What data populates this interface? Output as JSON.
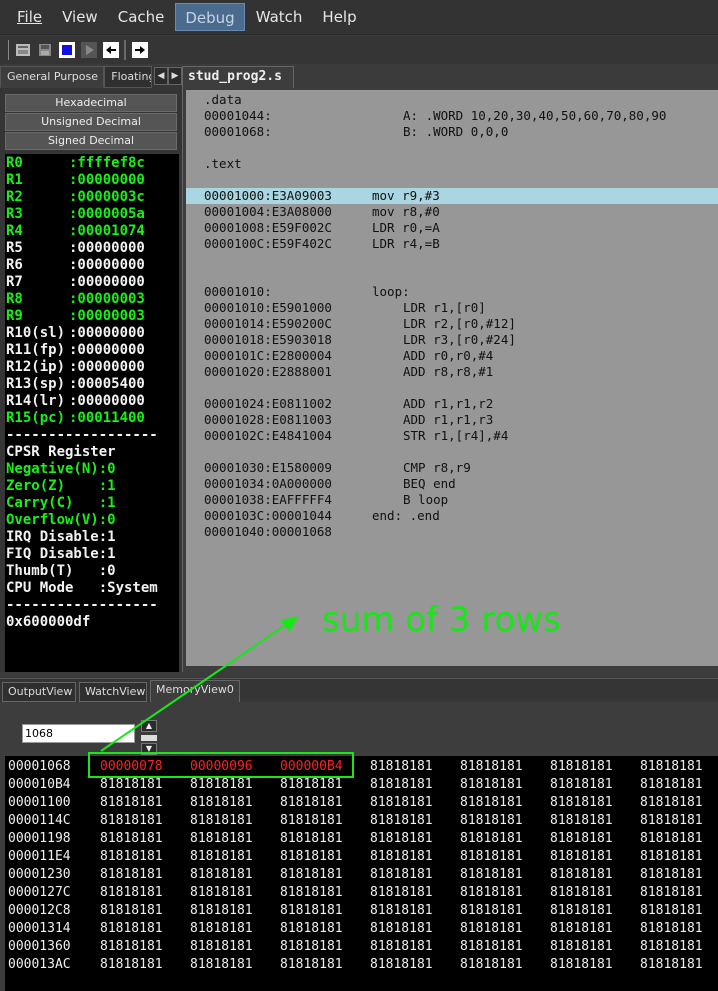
{
  "menu": [
    "File",
    "View",
    "Cache",
    "Debug",
    "Watch",
    "Help"
  ],
  "menu_active": "Debug",
  "toolbar_icons": [
    "open-file-icon",
    "save-file-icon",
    "stop-icon",
    "run-icon",
    "step-into-icon",
    "step-over-icon"
  ],
  "left_tabs": {
    "general": "General Purpose",
    "floating": "Floating"
  },
  "modes": [
    "Hexadecimal",
    "Unsigned Decimal",
    "Signed Decimal"
  ],
  "registers": [
    {
      "name": "R0",
      "value": ":ffffef8c",
      "color": "green"
    },
    {
      "name": "R1",
      "value": ":00000000",
      "color": "green"
    },
    {
      "name": "R2",
      "value": ":0000003c",
      "color": "green"
    },
    {
      "name": "R3",
      "value": ":0000005a",
      "color": "green"
    },
    {
      "name": "R4",
      "value": ":00001074",
      "color": "green"
    },
    {
      "name": "R5",
      "value": ":00000000",
      "color": "white"
    },
    {
      "name": "R6",
      "value": ":00000000",
      "color": "white"
    },
    {
      "name": "R7",
      "value": ":00000000",
      "color": "white"
    },
    {
      "name": "R8",
      "value": ":00000003",
      "color": "green"
    },
    {
      "name": "R9",
      "value": ":00000003",
      "color": "green"
    },
    {
      "name": "R10(sl)",
      "value": ":00000000",
      "color": "white"
    },
    {
      "name": "R11(fp)",
      "value": ":00000000",
      "color": "white"
    },
    {
      "name": "R12(ip)",
      "value": ":00000000",
      "color": "white"
    },
    {
      "name": "R13(sp)",
      "value": ":00005400",
      "color": "white"
    },
    {
      "name": "R14(lr)",
      "value": ":00000000",
      "color": "white"
    },
    {
      "name": "R15(pc)",
      "value": ":00011400",
      "color": "green"
    }
  ],
  "separator": "------------------",
  "cpsr_title": "CPSR Register",
  "cpsr": [
    {
      "text": "Negative(N):0",
      "color": "green"
    },
    {
      "text": "Zero(Z)    :1",
      "color": "green"
    },
    {
      "text": "Carry(C)   :1",
      "color": "green"
    },
    {
      "text": "Overflow(V):0",
      "color": "green"
    },
    {
      "text": "IRQ Disable:1",
      "color": "white"
    },
    {
      "text": "FIQ Disable:1",
      "color": "white"
    },
    {
      "text": "Thumb(T)   :0",
      "color": "white"
    },
    {
      "text": "CPU Mode   :System",
      "color": "white"
    }
  ],
  "cpsr_value": "0x600000df",
  "editor_tab": "stud_prog2.s",
  "code_lines": [
    {
      "a": ".data",
      "b": "",
      "c": ""
    },
    {
      "a": "00001044:",
      "b": "",
      "c": "A: .WORD 10,20,30,40,50,60,70,80,90"
    },
    {
      "a": "00001068:",
      "b": "",
      "c": "B: .WORD 0,0,0"
    },
    {
      "a": "",
      "b": "",
      "c": ""
    },
    {
      "a": ".text",
      "b": "",
      "c": ""
    },
    {
      "a": "",
      "b": "",
      "c": ""
    },
    {
      "a": "00001000:E3A09003",
      "b": "mov r9,#3",
      "c": "",
      "hl": true
    },
    {
      "a": "00001004:E3A08000",
      "b": "mov r8,#0",
      "c": ""
    },
    {
      "a": "00001008:E59F002C",
      "b": "LDR r0,=A",
      "c": ""
    },
    {
      "a": "0000100C:E59F402C",
      "b": "LDR r4,=B",
      "c": ""
    },
    {
      "a": "",
      "b": "",
      "c": ""
    },
    {
      "a": "",
      "b": "",
      "c": ""
    },
    {
      "a": "00001010:",
      "b": "loop:",
      "c": ""
    },
    {
      "a": "00001010:E5901000",
      "b": "",
      "c": "LDR r1,[r0]"
    },
    {
      "a": "00001014:E590200C",
      "b": "",
      "c": "LDR r2,[r0,#12]"
    },
    {
      "a": "00001018:E5903018",
      "b": "",
      "c": "LDR r3,[r0,#24]"
    },
    {
      "a": "0000101C:E2800004",
      "b": "",
      "c": "ADD r0,r0,#4"
    },
    {
      "a": "00001020:E2888001",
      "b": "",
      "c": "ADD r8,r8,#1"
    },
    {
      "a": "",
      "b": "",
      "c": ""
    },
    {
      "a": "00001024:E0811002",
      "b": "",
      "c": "ADD r1,r1,r2"
    },
    {
      "a": "00001028:E0811003",
      "b": "",
      "c": "ADD r1,r1,r3"
    },
    {
      "a": "0000102C:E4841004",
      "b": "",
      "c": "STR r1,[r4],#4"
    },
    {
      "a": "",
      "b": "",
      "c": ""
    },
    {
      "a": "00001030:E1580009",
      "b": "",
      "c": "CMP r8,r9"
    },
    {
      "a": "00001034:0A000000",
      "b": "",
      "c": "BEQ end"
    },
    {
      "a": "00001038:EAFFFFF4",
      "b": "",
      "c": "B loop"
    },
    {
      "a": "0000103C:00001044",
      "b": "end: .end",
      "c": ""
    },
    {
      "a": "00001040:00001068",
      "b": "",
      "c": ""
    }
  ],
  "annotation": "sum of 3 rows",
  "bottom_tabs": [
    "OutputView",
    "WatchView",
    "MemoryView0"
  ],
  "address_input": "1068",
  "memory_rows": [
    {
      "addr": "00001068",
      "cells": [
        "00000078",
        "00000096",
        "000000B4",
        "81818181",
        "81818181",
        "81818181",
        "81818181"
      ],
      "red": 3
    },
    {
      "addr": "000010B4",
      "cells": [
        "81818181",
        "81818181",
        "81818181",
        "81818181",
        "81818181",
        "81818181",
        "81818181"
      ]
    },
    {
      "addr": "00001100",
      "cells": [
        "81818181",
        "81818181",
        "81818181",
        "81818181",
        "81818181",
        "81818181",
        "81818181"
      ]
    },
    {
      "addr": "0000114C",
      "cells": [
        "81818181",
        "81818181",
        "81818181",
        "81818181",
        "81818181",
        "81818181",
        "81818181"
      ]
    },
    {
      "addr": "00001198",
      "cells": [
        "81818181",
        "81818181",
        "81818181",
        "81818181",
        "81818181",
        "81818181",
        "81818181"
      ]
    },
    {
      "addr": "000011E4",
      "cells": [
        "81818181",
        "81818181",
        "81818181",
        "81818181",
        "81818181",
        "81818181",
        "81818181"
      ]
    },
    {
      "addr": "00001230",
      "cells": [
        "81818181",
        "81818181",
        "81818181",
        "81818181",
        "81818181",
        "81818181",
        "81818181"
      ]
    },
    {
      "addr": "0000127C",
      "cells": [
        "81818181",
        "81818181",
        "81818181",
        "81818181",
        "81818181",
        "81818181",
        "81818181"
      ]
    },
    {
      "addr": "000012C8",
      "cells": [
        "81818181",
        "81818181",
        "81818181",
        "81818181",
        "81818181",
        "81818181",
        "81818181"
      ]
    },
    {
      "addr": "00001314",
      "cells": [
        "81818181",
        "81818181",
        "81818181",
        "81818181",
        "81818181",
        "81818181",
        "81818181"
      ]
    },
    {
      "addr": "00001360",
      "cells": [
        "81818181",
        "81818181",
        "81818181",
        "81818181",
        "81818181",
        "81818181",
        "81818181"
      ]
    },
    {
      "addr": "000013AC",
      "cells": [
        "81818181",
        "81818181",
        "81818181",
        "81818181",
        "81818181",
        "81818181",
        "81818181"
      ]
    }
  ],
  "colors": {
    "register_green": "#18f018",
    "annotation_green": "#19e519",
    "changed_red": "#ff2020",
    "highlight_line": "#a9d6e2"
  }
}
